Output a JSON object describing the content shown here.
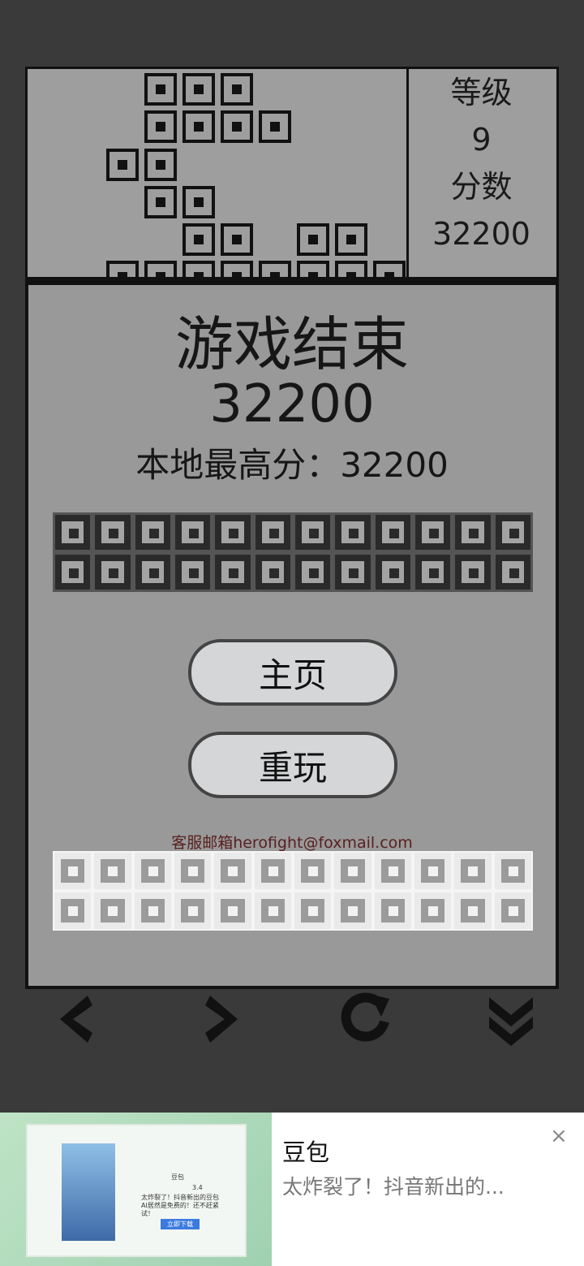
{
  "sidebar": {
    "level_label": "等级",
    "level_value": "9",
    "score_label": "分数",
    "score_value": "32200"
  },
  "gameover": {
    "title": "游戏结束",
    "score": "32200",
    "best": "本地最高分：32200",
    "home_button": "主页",
    "replay_button": "重玩",
    "contact": "客服邮箱herofight@foxmail.com"
  },
  "ad": {
    "title": "豆包",
    "description": "太炸裂了！抖音新出的...",
    "close": "×",
    "image_app_name": "豆包",
    "image_rating": "3.4",
    "image_text": "太炸裂了！抖音新出的豆包AI居然是免费的！还不赶紧试！",
    "image_button": "立即下载"
  },
  "colors": {
    "background": "#3a3a3a",
    "panel": "#999999",
    "block": "#111111",
    "button": "#d4d6d8"
  }
}
